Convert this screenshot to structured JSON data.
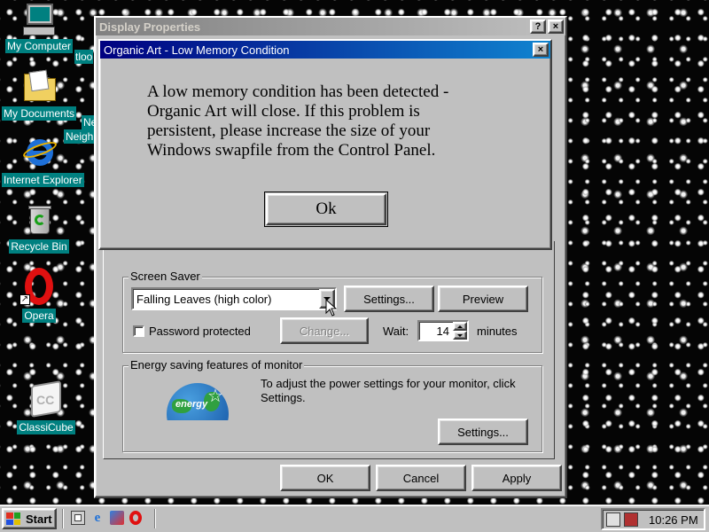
{
  "desktop": {
    "icons": [
      {
        "label": "My Computer",
        "icon": "my-computer-icon"
      },
      {
        "label": "My Documents",
        "icon": "my-documents-icon"
      },
      {
        "label": "Internet Explorer",
        "icon": "internet-explorer-icon"
      },
      {
        "label": "Recycle Bin",
        "icon": "recycle-bin-icon"
      },
      {
        "label": "Opera",
        "icon": "opera-icon"
      },
      {
        "label": "ClassiCube",
        "icon": "classicube-icon"
      }
    ],
    "partial_labels": [
      "tloo",
      "Ne",
      "Neigh"
    ]
  },
  "display_properties": {
    "title": "Display Properties",
    "help_label": "?",
    "close_label": "×",
    "screen_saver": {
      "group_label": "Screen Saver",
      "selected": "Falling Leaves (high color)",
      "settings_button": "Settings...",
      "preview_button": "Preview",
      "password_label": "Password protected",
      "password_checked": false,
      "change_button": "Change...",
      "wait_label": "Wait:",
      "wait_value": "14",
      "minutes_label": "minutes"
    },
    "energy": {
      "group_label": "Energy saving features of monitor",
      "description": "To adjust the power settings for your monitor, click Settings.",
      "settings_button": "Settings...",
      "logo_text": "energy"
    },
    "buttons": {
      "ok": "OK",
      "cancel": "Cancel",
      "apply": "Apply"
    }
  },
  "dialog": {
    "title": "Organic Art - Low Memory Condition",
    "close_label": "×",
    "message": "A low memory condition has been detected - Organic Art will close.  If this problem is persistent, please increase the size of your Windows swapfile from the Control Panel.",
    "ok_button": "Ok"
  },
  "taskbar": {
    "start_label": "Start",
    "quick_launch": [
      "desktop-icon",
      "internet-explorer-icon",
      "channels-icon",
      "opera-icon"
    ],
    "tray_icons": [
      "scheduler-icon",
      "volume-icon"
    ],
    "clock": "10:26 PM"
  },
  "colors": {
    "desktop_bg": "#050505",
    "teal": "#008080",
    "titlebar_active": "#000080",
    "face": "#c0c0c0"
  }
}
